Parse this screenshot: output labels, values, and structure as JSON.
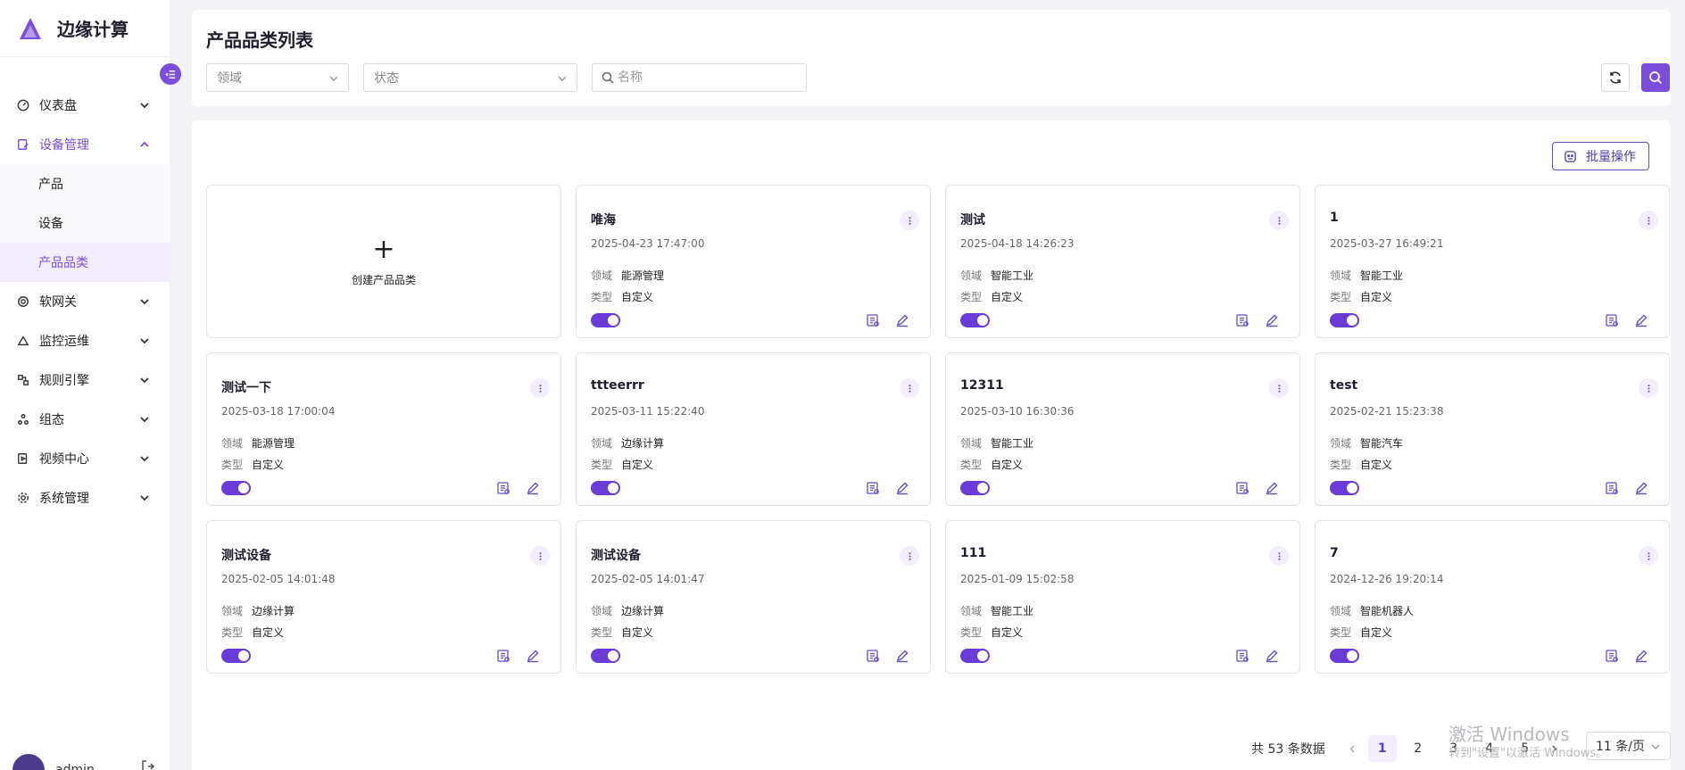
{
  "app": {
    "title": "边缘计算"
  },
  "sidebar": {
    "items": [
      {
        "label": "仪表盘",
        "icon": "gauge-icon"
      },
      {
        "label": "设备管理",
        "icon": "device-manage-icon",
        "expanded": true,
        "children": [
          {
            "label": "产品"
          },
          {
            "label": "设备"
          },
          {
            "label": "产品品类",
            "active": true
          }
        ]
      },
      {
        "label": "软网关",
        "icon": "gateway-icon"
      },
      {
        "label": "监控运维",
        "icon": "monitor-icon"
      },
      {
        "label": "规则引擎",
        "icon": "rule-engine-icon"
      },
      {
        "label": "组态",
        "icon": "configuration-icon"
      },
      {
        "label": "视频中心",
        "icon": "video-icon"
      },
      {
        "label": "系统管理",
        "icon": "gear-icon"
      }
    ]
  },
  "user": {
    "name": "admin"
  },
  "header": {
    "title": "产品品类列表",
    "filters": {
      "domain_placeholder": "领域",
      "status_placeholder": "状态",
      "name_placeholder": "名称"
    }
  },
  "toolbar": {
    "batch_label": "批量操作"
  },
  "create_card": {
    "plus": "+",
    "label": "创建产品品类"
  },
  "card_labels": {
    "domain": "领域",
    "type": "类型"
  },
  "cards": [
    {
      "name": "唯海",
      "time": "2025-04-23 17:47:00",
      "domain": "能源管理",
      "type": "自定义",
      "enabled": true
    },
    {
      "name": "测试",
      "time": "2025-04-18 14:26:23",
      "domain": "智能工业",
      "type": "自定义",
      "enabled": true
    },
    {
      "name": "1",
      "time": "2025-03-27 16:49:21",
      "domain": "智能工业",
      "type": "自定义",
      "enabled": true
    },
    {
      "name": "测试一下",
      "time": "2025-03-18 17:00:04",
      "domain": "能源管理",
      "type": "自定义",
      "enabled": true
    },
    {
      "name": "ttteerrr",
      "time": "2025-03-11 15:22:40",
      "domain": "边缘计算",
      "type": "自定义",
      "enabled": true
    },
    {
      "name": "12311",
      "time": "2025-03-10 16:30:36",
      "domain": "智能工业",
      "type": "自定义",
      "enabled": true
    },
    {
      "name": "test",
      "time": "2025-02-21 15:23:38",
      "domain": "智能汽车",
      "type": "自定义",
      "enabled": true
    },
    {
      "name": "测试设备",
      "time": "2025-02-05 14:01:48",
      "domain": "边缘计算",
      "type": "自定义",
      "enabled": true
    },
    {
      "name": "测试设备",
      "time": "2025-02-05 14:01:47",
      "domain": "边缘计算",
      "type": "自定义",
      "enabled": true
    },
    {
      "name": "111",
      "time": "2025-01-09 15:02:58",
      "domain": "智能工业",
      "type": "自定义",
      "enabled": true
    },
    {
      "name": "7",
      "time": "2024-12-26 19:20:14",
      "domain": "智能机器人",
      "type": "自定义",
      "enabled": true
    }
  ],
  "pagination": {
    "total_text": "共 53 条数据",
    "pages": [
      "1",
      "2",
      "3",
      "4",
      "5"
    ],
    "current": "1",
    "page_size": "11 条/页"
  },
  "watermark": {
    "line1": "激活 Windows",
    "line2": "转到\"设置\"以激活 Windows。"
  },
  "colors": {
    "accent": "#7c4ddb",
    "toggle_on": "#6a3bd6",
    "active_bg": "#f3edfd"
  }
}
